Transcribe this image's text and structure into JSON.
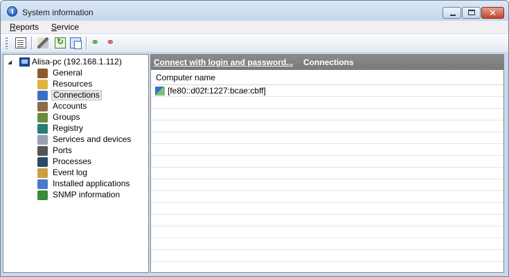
{
  "window": {
    "title": "System information",
    "controls": {
      "minimize": "minimize",
      "maximize": "maximize",
      "close": "✕"
    }
  },
  "menu": [
    {
      "label": "Reports",
      "mnemonic": "R",
      "rest": "eports"
    },
    {
      "label": "Service",
      "mnemonic": "S",
      "rest": "ervice"
    }
  ],
  "toolbar": {
    "buttons": [
      "report-icon",
      "service-icon",
      "refresh-icon",
      "copy-icon",
      "connect-icon",
      "disconnect-icon"
    ]
  },
  "tree": {
    "root": "Alisa-pc (192.168.1.112)",
    "items": [
      {
        "label": "General",
        "icon": "general-icon",
        "color": "#8a5a2e"
      },
      {
        "label": "Resources",
        "icon": "resources-icon",
        "color": "#e0b43c"
      },
      {
        "label": "Connections",
        "icon": "connections-icon",
        "color": "#3b6fc4",
        "selected": true
      },
      {
        "label": "Accounts",
        "icon": "accounts-icon",
        "color": "#8c6a4a"
      },
      {
        "label": "Groups",
        "icon": "groups-icon",
        "color": "#6a8c3c"
      },
      {
        "label": "Registry",
        "icon": "registry-icon",
        "color": "#2d7a7a"
      },
      {
        "label": "Services and devices",
        "icon": "services-icon",
        "color": "#9aa2b0"
      },
      {
        "label": "Ports",
        "icon": "ports-icon",
        "color": "#555555"
      },
      {
        "label": "Processes",
        "icon": "processes-icon",
        "color": "#2a4a6a"
      },
      {
        "label": "Event log",
        "icon": "event-log-icon",
        "color": "#c8a040"
      },
      {
        "label": "Installed applications",
        "icon": "installed-apps-icon",
        "color": "#4a7ac8"
      },
      {
        "label": "SNMP information",
        "icon": "snmp-icon",
        "color": "#3a8a3a"
      }
    ]
  },
  "main": {
    "link": "Connect with login and password...",
    "title": "Connections",
    "column": "Computer name",
    "rows": [
      "[fe80::d02f:1227:bcae:cbff]"
    ]
  },
  "colors": {
    "header_strip": "#808080",
    "selection": "#e5e5e5",
    "frame": "#c9d9ee"
  }
}
